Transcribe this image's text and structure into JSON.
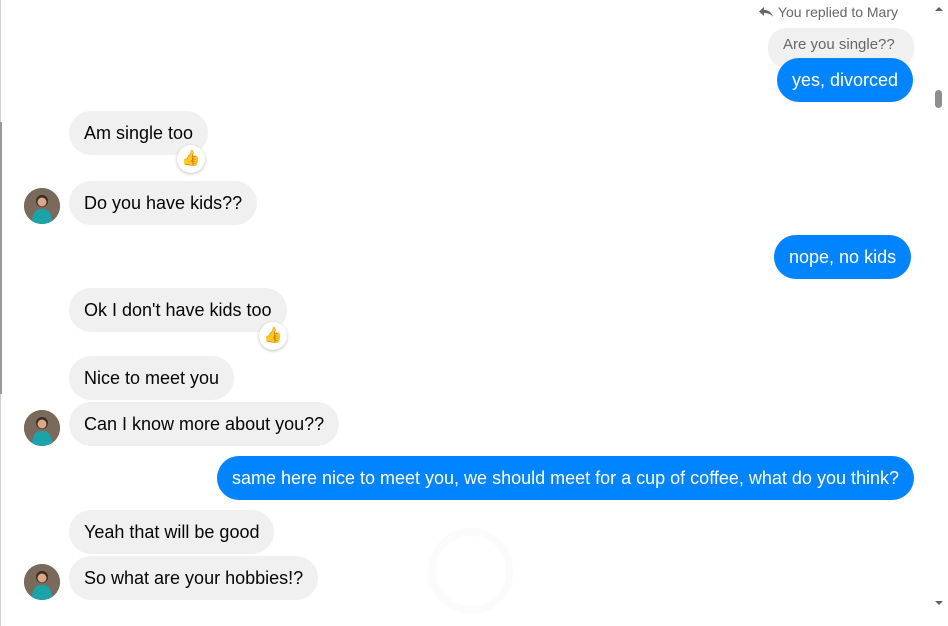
{
  "reply_context": {
    "label": "You replied to Mary",
    "quoted_text": "Are you single??"
  },
  "messages": [
    {
      "direction": "out",
      "text": "yes, divorced"
    },
    {
      "direction": "in",
      "text": "Am single too",
      "reaction": "thumbs-up"
    },
    {
      "direction": "in",
      "text": "Do you have kids??",
      "avatar": true
    },
    {
      "direction": "out",
      "text": "nope, no kids"
    },
    {
      "direction": "in",
      "text": "Ok I don't have kids too",
      "reaction": "thumbs-up"
    },
    {
      "direction": "in",
      "text": "Nice to meet you"
    },
    {
      "direction": "in",
      "text": "Can I know more about you??",
      "avatar": true
    },
    {
      "direction": "out",
      "text": "same here nice to meet you, we should meet for a cup of coffee, what do  you think?"
    },
    {
      "direction": "in",
      "text": "Yeah that will be good"
    },
    {
      "direction": "in",
      "text": "So what are your hobbies!?",
      "avatar": true
    }
  ],
  "reaction_glyph": "👍",
  "colors": {
    "outgoing_bubble": "#0084ff",
    "incoming_bubble": "#f0f0f0",
    "secondary_text": "#65676b"
  },
  "icons": {
    "reply": "reply-arrow-icon",
    "avatar": "contact-avatar",
    "reaction": "thumbs-up-icon",
    "scroll_up": "scroll-up-arrow-icon",
    "scroll_down": "scroll-down-arrow-icon"
  }
}
